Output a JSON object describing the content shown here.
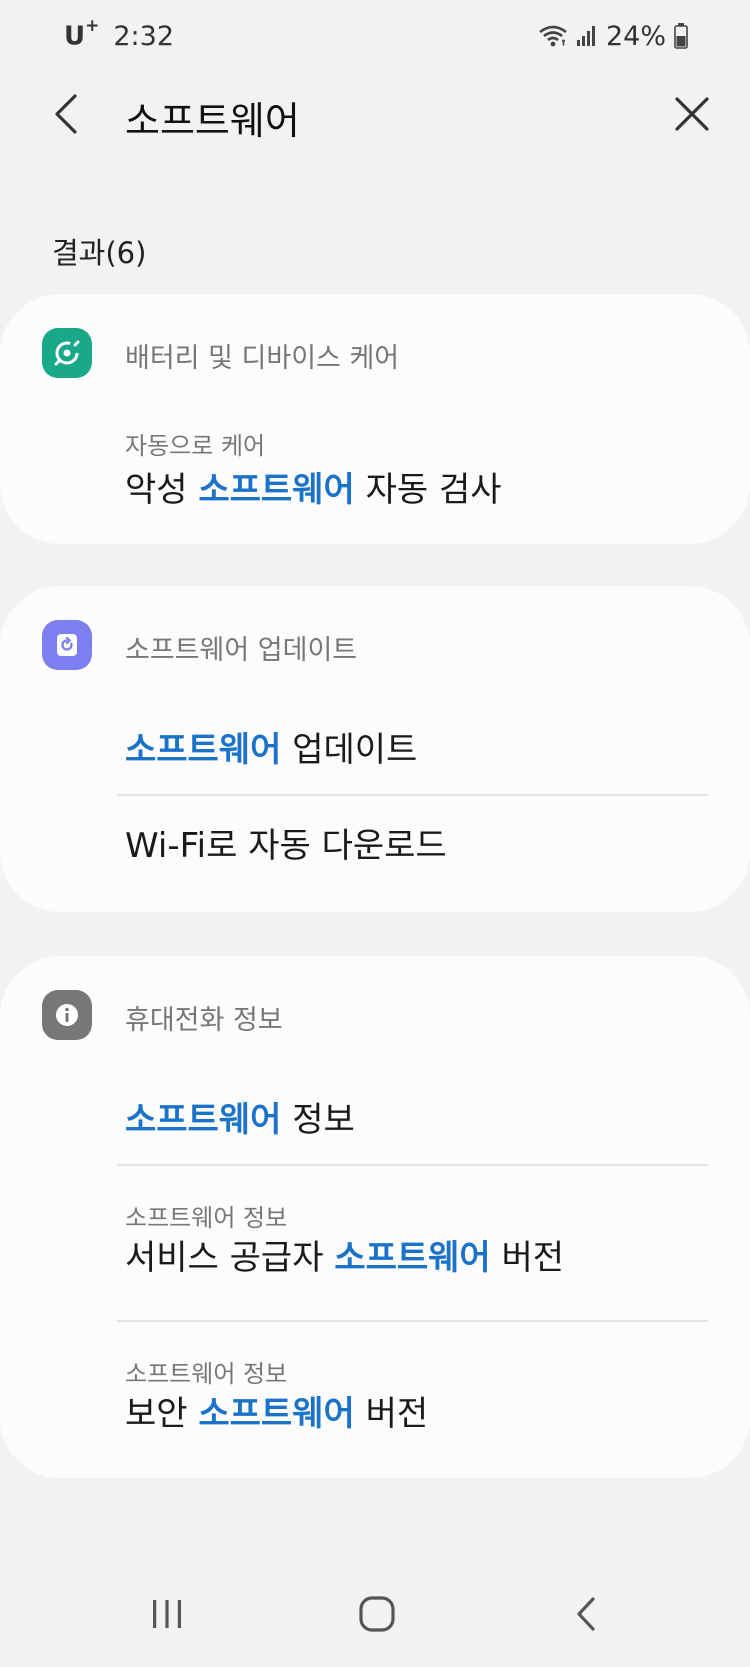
{
  "status_bar": {
    "carrier": "U",
    "carrier_sup": "+",
    "time": "2:32",
    "battery": "24%"
  },
  "header": {
    "title": "소프트웨어"
  },
  "results": {
    "label": "결과(6)"
  },
  "cards": [
    {
      "category": "배터리 및 디바이스 케어",
      "icon": "device-care-icon",
      "icon_color": "#1aa88a",
      "items": [
        {
          "sub": "자동으로 케어",
          "pre": "악성 ",
          "hl": "소프트웨어",
          "post": " 자동 검사"
        }
      ]
    },
    {
      "category": "소프트웨어 업데이트",
      "icon": "software-update-icon",
      "icon_color": "#7b7ff0",
      "items": [
        {
          "pre": "",
          "hl": "소프트웨어",
          "post": " 업데이트"
        },
        {
          "text": "Wi-Fi로 자동 다운로드"
        }
      ]
    },
    {
      "category": "휴대전화 정보",
      "icon": "info-icon",
      "icon_color": "#777777",
      "items": [
        {
          "pre": "",
          "hl": "소프트웨어",
          "post": " 정보"
        },
        {
          "sub": "소프트웨어 정보",
          "pre": "서비스 공급자 ",
          "hl": "소프트웨어",
          "post": " 버전"
        },
        {
          "sub": "소프트웨어 정보",
          "pre": "보안 ",
          "hl": "소프트웨어",
          "post": " 버전"
        }
      ]
    }
  ],
  "colors": {
    "highlight": "#1a73c9",
    "background": "#f2f2f2",
    "card": "#fcfcfc"
  }
}
